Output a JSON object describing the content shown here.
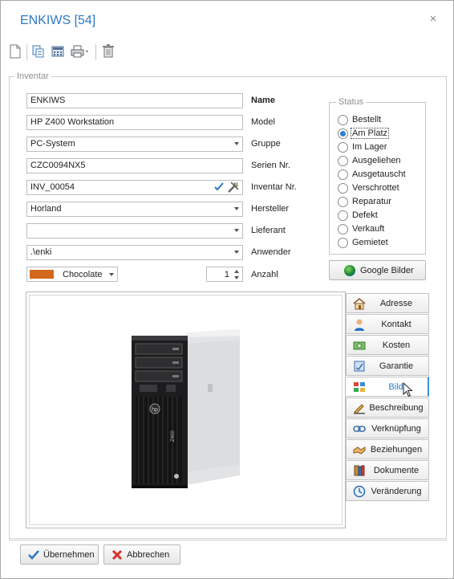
{
  "window": {
    "title": "ENKIWS [54]",
    "close_glyph": "×"
  },
  "toolbar": {
    "icons": [
      "new-document-icon",
      "copy-icon",
      "calculator-icon",
      "print-icon",
      "delete-icon"
    ]
  },
  "group": {
    "legend": "Inventar"
  },
  "fields": {
    "name": {
      "value": "ENKIWS",
      "label": "Name"
    },
    "model": {
      "value": "HP Z400 Workstation",
      "label": "Model"
    },
    "gruppe": {
      "value": "PC-System",
      "label": "Gruppe"
    },
    "serien": {
      "value": "CZC0094NX5",
      "label": "Serien Nr."
    },
    "inventar": {
      "value": "INV_00054",
      "label": "Inventar Nr."
    },
    "hersteller": {
      "value": "Horland",
      "label": "Hersteller"
    },
    "lieferant": {
      "value": "",
      "label": "Lieferant"
    },
    "anwender": {
      "value": ".\\enki",
      "label": "Anwender"
    },
    "farbe": {
      "value": "Chocolate",
      "swatch": "#d2691e"
    },
    "anzahl": {
      "value": "1",
      "label": "Anzahl"
    }
  },
  "status": {
    "legend": "Status",
    "selected": "Am Platz",
    "options": [
      "Bestellt",
      "Am Platz",
      "Im Lager",
      "Ausgeliehen",
      "Ausgetauscht",
      "Verschrottet",
      "Reparatur",
      "Defekt",
      "Verkauft",
      "Gemietet"
    ]
  },
  "google_button": {
    "label": "Google Bilder"
  },
  "tabs": [
    {
      "label": "Adresse",
      "icon": "home-icon"
    },
    {
      "label": "Kontakt",
      "icon": "person-icon"
    },
    {
      "label": "Kosten",
      "icon": "money-icon"
    },
    {
      "label": "Garantie",
      "icon": "warranty-icon"
    },
    {
      "label": "Bild",
      "icon": "image-grid-icon",
      "active": true
    },
    {
      "label": "Beschreibung",
      "icon": "pencil-icon"
    },
    {
      "label": "Verknüpfung",
      "icon": "link-icon"
    },
    {
      "label": "Beziehungen",
      "icon": "handshake-icon"
    },
    {
      "label": "Dokumente",
      "icon": "documents-icon"
    },
    {
      "label": "Veränderung",
      "icon": "clock-icon"
    }
  ],
  "footer": {
    "ok_label": "Übernehmen",
    "cancel_label": "Abbrechen"
  },
  "image": {
    "alt_icon": "hp-workstation-tower-image",
    "brand": "hp",
    "model_text": "Z400"
  },
  "colors": {
    "accent": "#2b79c2",
    "active_tab_border": "#3b8edb"
  }
}
